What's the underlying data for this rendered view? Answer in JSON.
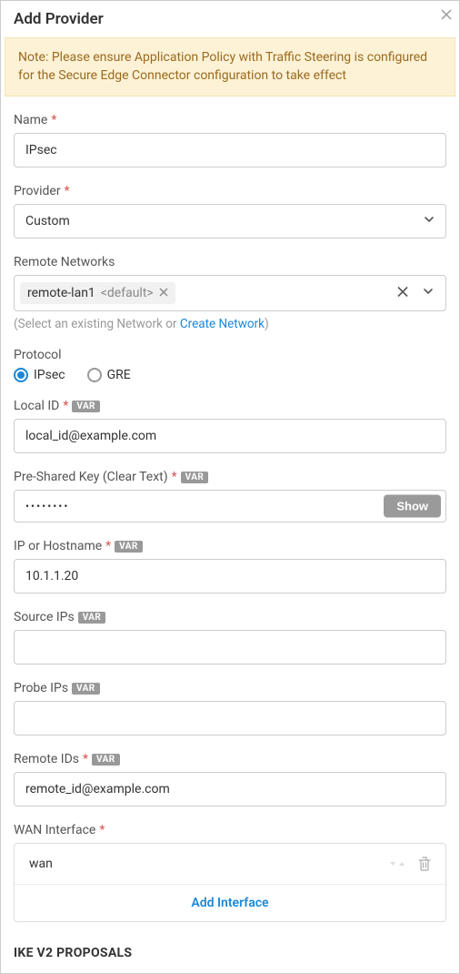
{
  "header": {
    "title": "Add Provider"
  },
  "note": "Note: Please ensure Application Policy with Traffic Steering is configured for the Secure Edge Connector configuration to take effect",
  "labels": {
    "name": "Name",
    "provider": "Provider",
    "remote_networks": "Remote Networks",
    "protocol": "Protocol",
    "local_id": "Local ID",
    "psk": "Pre-Shared Key (Clear Text)",
    "ip_hostname": "IP or Hostname",
    "source_ips": "Source IPs",
    "probe_ips": "Probe IPs",
    "remote_ids": "Remote IDs",
    "wan_interface": "WAN Interface",
    "var": "VAR"
  },
  "values": {
    "name": "IPsec",
    "provider": "Custom",
    "remote_network_chip": "remote-lan1",
    "remote_network_chip_default": "<default>",
    "protocol_ipsec": "IPsec",
    "protocol_gre": "GRE",
    "local_id": "local_id@example.com",
    "psk": "••••••••",
    "ip_hostname": "10.1.1.20",
    "source_ips": "",
    "probe_ips": "",
    "remote_ids": "remote_id@example.com",
    "wan_row": "wan"
  },
  "hints": {
    "remote_networks_prefix": "(Select an existing Network or ",
    "remote_networks_link": "Create Network",
    "remote_networks_suffix": ")"
  },
  "buttons": {
    "show": "Show",
    "add_interface": "Add Interface"
  },
  "sections": {
    "ike": "IKE V2 PROPOSALS"
  }
}
